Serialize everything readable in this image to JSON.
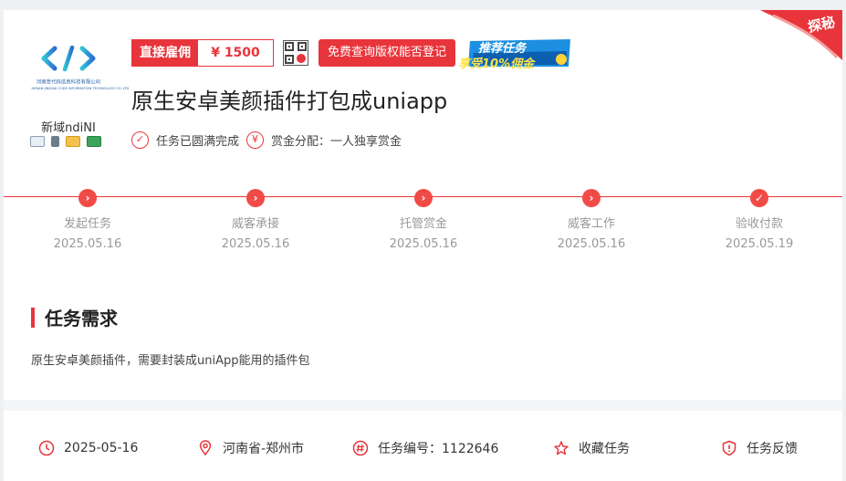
{
  "ribbon": {
    "text": "探秘"
  },
  "employer": {
    "logo_text": "河南景代码信息科技有限公司",
    "logo_subtext": "HENAN JINGDAI CODE INFORMATION TECHNOLOGY CO.,LTD",
    "name": "新域ndiNI",
    "cert_icons": [
      "id-card-icon",
      "phone-icon",
      "email-icon",
      "bank-card-icon"
    ]
  },
  "tags": {
    "hire_label": "直接雇佣",
    "price": "¥  1500",
    "check_button": "免费查询版权能否登记",
    "promo_line1": "推荐任务",
    "promo_line2": "享受10%佣金"
  },
  "task": {
    "title": "原生安卓美颜插件打包成uniapp",
    "status": "任务已圆满完成",
    "reward_mode": "赏金分配：一人独享赏金"
  },
  "progress": [
    {
      "label": "发起任务",
      "date": "2025.05.16",
      "icon": "chevron-right-icon"
    },
    {
      "label": "威客承接",
      "date": "2025.05.16",
      "icon": "chevron-right-icon"
    },
    {
      "label": "托管赏金",
      "date": "2025.05.16",
      "icon": "chevron-right-icon"
    },
    {
      "label": "威客工作",
      "date": "2025.05.16",
      "icon": "chevron-right-icon"
    },
    {
      "label": "验收付款",
      "date": "2025.05.19",
      "icon": "check-icon"
    }
  ],
  "requirements": {
    "heading": "任务需求",
    "description": "原生安卓美颜插件，需要封装成uniApp能用的插件包"
  },
  "footer": {
    "date": "2025-05-16",
    "location": "河南省-郑州市",
    "task_no": "任务编号：1122646",
    "favorite": "收藏任务",
    "feedback": "任务反馈"
  },
  "colors": {
    "accent": "#e8353b",
    "muted": "#999999"
  }
}
